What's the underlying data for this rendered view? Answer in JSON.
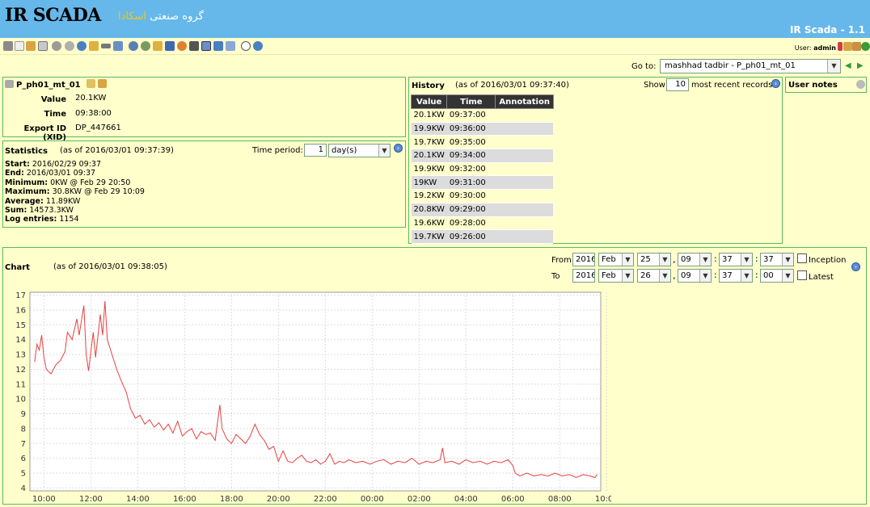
{
  "header": {
    "logo": "IR SCADA",
    "company_prefix": "گروه صنعتی",
    "company_brand": "اسکادا",
    "version": "IR Scada - 1.1"
  },
  "toolbar": {
    "icons": [
      "eye-icon",
      "new-page-icon",
      "edit-icon",
      "document-icon",
      "settings-icon",
      "gear-icon",
      "clock-icon",
      "wrench-icon",
      "link-icon",
      "report-icon",
      "users-icon",
      "user-icon",
      "folder-icon",
      "save-icon",
      "config-icon",
      "tools-icon",
      "list-icon",
      "export-icon",
      "import-icon",
      "radio-icon",
      "help-icon"
    ],
    "user_prefix": "User:",
    "user_name": "admin"
  },
  "goto": {
    "label": "Go to:",
    "selected": "mashhad tadbir - P_ph01_mt_01"
  },
  "point": {
    "name": "P_ph01_mt_01",
    "value_label": "Value",
    "value": "20.1KW",
    "time_label": "Time",
    "time": "09:38:00",
    "xid_label": "Export ID (XID)",
    "xid": "DP_447661"
  },
  "statistics": {
    "title": "Statistics",
    "as_of": "(as of 2016/03/01 09:37:39)",
    "period_label": "Time period:",
    "period_value": "1",
    "period_unit": "day(s)",
    "rows": [
      {
        "label": "Start:",
        "value": "2016/02/29 09:37"
      },
      {
        "label": "End:",
        "value": "2016/03/01 09:37"
      },
      {
        "label": "Minimum:",
        "value": "0KW @ Feb 29 20:50"
      },
      {
        "label": "Maximum:",
        "value": "30.8KW @ Feb 29 10:09"
      },
      {
        "label": "Average:",
        "value": "11.89KW"
      },
      {
        "label": "Sum:",
        "value": "14573.3KW"
      },
      {
        "label": "Log entries:",
        "value": "1154"
      }
    ]
  },
  "history": {
    "title": "History",
    "as_of": "(as of 2016/03/01 09:37:40)",
    "show_label": "Show",
    "show_count": "10",
    "show_suffix": "most recent records",
    "columns": [
      "Value",
      "Time",
      "Annotation"
    ],
    "rows": [
      {
        "value": "20.1KW",
        "time": "09:37:00"
      },
      {
        "value": "19.9KW",
        "time": "09:36:00"
      },
      {
        "value": "19.7KW",
        "time": "09:35:00"
      },
      {
        "value": "20.1KW",
        "time": "09:34:00"
      },
      {
        "value": "19.9KW",
        "time": "09:32:00"
      },
      {
        "value": "19KW",
        "time": "09:31:00"
      },
      {
        "value": "19.2KW",
        "time": "09:30:00"
      },
      {
        "value": "20.8KW",
        "time": "09:29:00"
      },
      {
        "value": "19.6KW",
        "time": "09:28:00"
      },
      {
        "value": "19.7KW",
        "time": "09:26:00"
      }
    ]
  },
  "notes": {
    "title": "User notes"
  },
  "chart_panel": {
    "title": "Chart",
    "as_of": "(as of 2016/03/01 09:38:05)",
    "from_label": "From",
    "to_label": "To",
    "from": {
      "year": "2016",
      "month": "Feb",
      "day": "25",
      "hour": "09",
      "minute": "37",
      "second": "37"
    },
    "to": {
      "year": "2016",
      "month": "Feb",
      "day": "26",
      "hour": "09",
      "minute": "37",
      "second": "00"
    },
    "inception_label": "Inception",
    "latest_label": "Latest"
  },
  "chart_data": {
    "type": "line",
    "x_ticks": [
      "10:00",
      "12:00",
      "14:00",
      "16:00",
      "18:00",
      "20:00",
      "22:00",
      "00:00",
      "02:00",
      "04:00",
      "06:00",
      "08:00",
      "10:00"
    ],
    "y_ticks": [
      4,
      5,
      6,
      7,
      8,
      9,
      10,
      11,
      12,
      13,
      14,
      15,
      16,
      17
    ],
    "ylim": [
      3.8,
      17.2
    ],
    "xlim_hours": [
      9.4,
      33.75
    ],
    "series": [
      {
        "color": "#e84040",
        "points": [
          [
            9.6,
            12.5
          ],
          [
            9.7,
            13.7
          ],
          [
            9.8,
            13.3
          ],
          [
            9.9,
            14.3
          ],
          [
            10.0,
            12.8
          ],
          [
            10.1,
            12.0
          ],
          [
            10.3,
            11.7
          ],
          [
            10.5,
            12.3
          ],
          [
            10.7,
            12.6
          ],
          [
            10.9,
            13.2
          ],
          [
            11.0,
            14.5
          ],
          [
            11.2,
            14.0
          ],
          [
            11.4,
            15.4
          ],
          [
            11.5,
            14.3
          ],
          [
            11.7,
            16.3
          ],
          [
            11.8,
            13.0
          ],
          [
            11.9,
            11.9
          ],
          [
            12.1,
            14.5
          ],
          [
            12.2,
            12.8
          ],
          [
            12.4,
            15.7
          ],
          [
            12.5,
            14.3
          ],
          [
            12.6,
            16.6
          ],
          [
            12.7,
            14.0
          ],
          [
            12.9,
            13.0
          ],
          [
            13.1,
            12.0
          ],
          [
            13.3,
            11.2
          ],
          [
            13.5,
            10.5
          ],
          [
            13.7,
            9.3
          ],
          [
            13.9,
            8.7
          ],
          [
            14.1,
            8.9
          ],
          [
            14.3,
            8.3
          ],
          [
            14.5,
            8.6
          ],
          [
            14.7,
            8.1
          ],
          [
            14.9,
            8.4
          ],
          [
            15.1,
            7.9
          ],
          [
            15.3,
            8.3
          ],
          [
            15.5,
            7.7
          ],
          [
            15.7,
            8.5
          ],
          [
            15.9,
            7.5
          ],
          [
            16.1,
            7.8
          ],
          [
            16.3,
            8.0
          ],
          [
            16.5,
            7.3
          ],
          [
            16.7,
            7.8
          ],
          [
            16.9,
            7.6
          ],
          [
            17.1,
            7.7
          ],
          [
            17.3,
            7.2
          ],
          [
            17.5,
            9.6
          ],
          [
            17.6,
            8.0
          ],
          [
            17.8,
            7.3
          ],
          [
            18.0,
            7.0
          ],
          [
            18.2,
            7.6
          ],
          [
            18.4,
            7.3
          ],
          [
            18.6,
            7.0
          ],
          [
            18.8,
            7.5
          ],
          [
            19.0,
            8.3
          ],
          [
            19.2,
            7.6
          ],
          [
            19.4,
            7.2
          ],
          [
            19.6,
            6.6
          ],
          [
            19.8,
            6.8
          ],
          [
            20.0,
            5.8
          ],
          [
            20.2,
            6.5
          ],
          [
            20.4,
            5.8
          ],
          [
            20.6,
            5.7
          ],
          [
            20.8,
            6.0
          ],
          [
            21.0,
            6.2
          ],
          [
            21.2,
            5.8
          ],
          [
            21.4,
            5.7
          ],
          [
            21.6,
            5.9
          ],
          [
            21.8,
            5.6
          ],
          [
            22.0,
            5.8
          ],
          [
            22.2,
            6.3
          ],
          [
            22.4,
            5.6
          ],
          [
            22.6,
            5.8
          ],
          [
            22.8,
            5.7
          ],
          [
            23.0,
            5.9
          ],
          [
            23.3,
            5.7
          ],
          [
            23.6,
            5.8
          ],
          [
            23.9,
            5.6
          ],
          [
            24.2,
            5.8
          ],
          [
            24.5,
            5.9
          ],
          [
            24.8,
            5.6
          ],
          [
            25.1,
            5.8
          ],
          [
            25.4,
            5.7
          ],
          [
            25.7,
            6.0
          ],
          [
            26.0,
            5.6
          ],
          [
            26.3,
            5.8
          ],
          [
            26.6,
            5.7
          ],
          [
            26.9,
            5.9
          ],
          [
            27.0,
            6.7
          ],
          [
            27.1,
            5.7
          ],
          [
            27.4,
            5.8
          ],
          [
            27.7,
            5.6
          ],
          [
            28.0,
            5.9
          ],
          [
            28.3,
            5.7
          ],
          [
            28.6,
            5.8
          ],
          [
            28.9,
            5.6
          ],
          [
            29.2,
            5.8
          ],
          [
            29.5,
            5.7
          ],
          [
            29.8,
            5.9
          ],
          [
            30.0,
            5.5
          ],
          [
            30.1,
            5.0
          ],
          [
            30.3,
            4.8
          ],
          [
            30.6,
            5.0
          ],
          [
            30.9,
            4.8
          ],
          [
            31.2,
            4.9
          ],
          [
            31.5,
            4.8
          ],
          [
            31.8,
            5.0
          ],
          [
            32.1,
            4.8
          ],
          [
            32.4,
            4.9
          ],
          [
            32.7,
            4.7
          ],
          [
            33.0,
            4.9
          ],
          [
            33.3,
            4.8
          ],
          [
            33.5,
            4.7
          ],
          [
            33.6,
            4.9
          ]
        ]
      }
    ]
  }
}
